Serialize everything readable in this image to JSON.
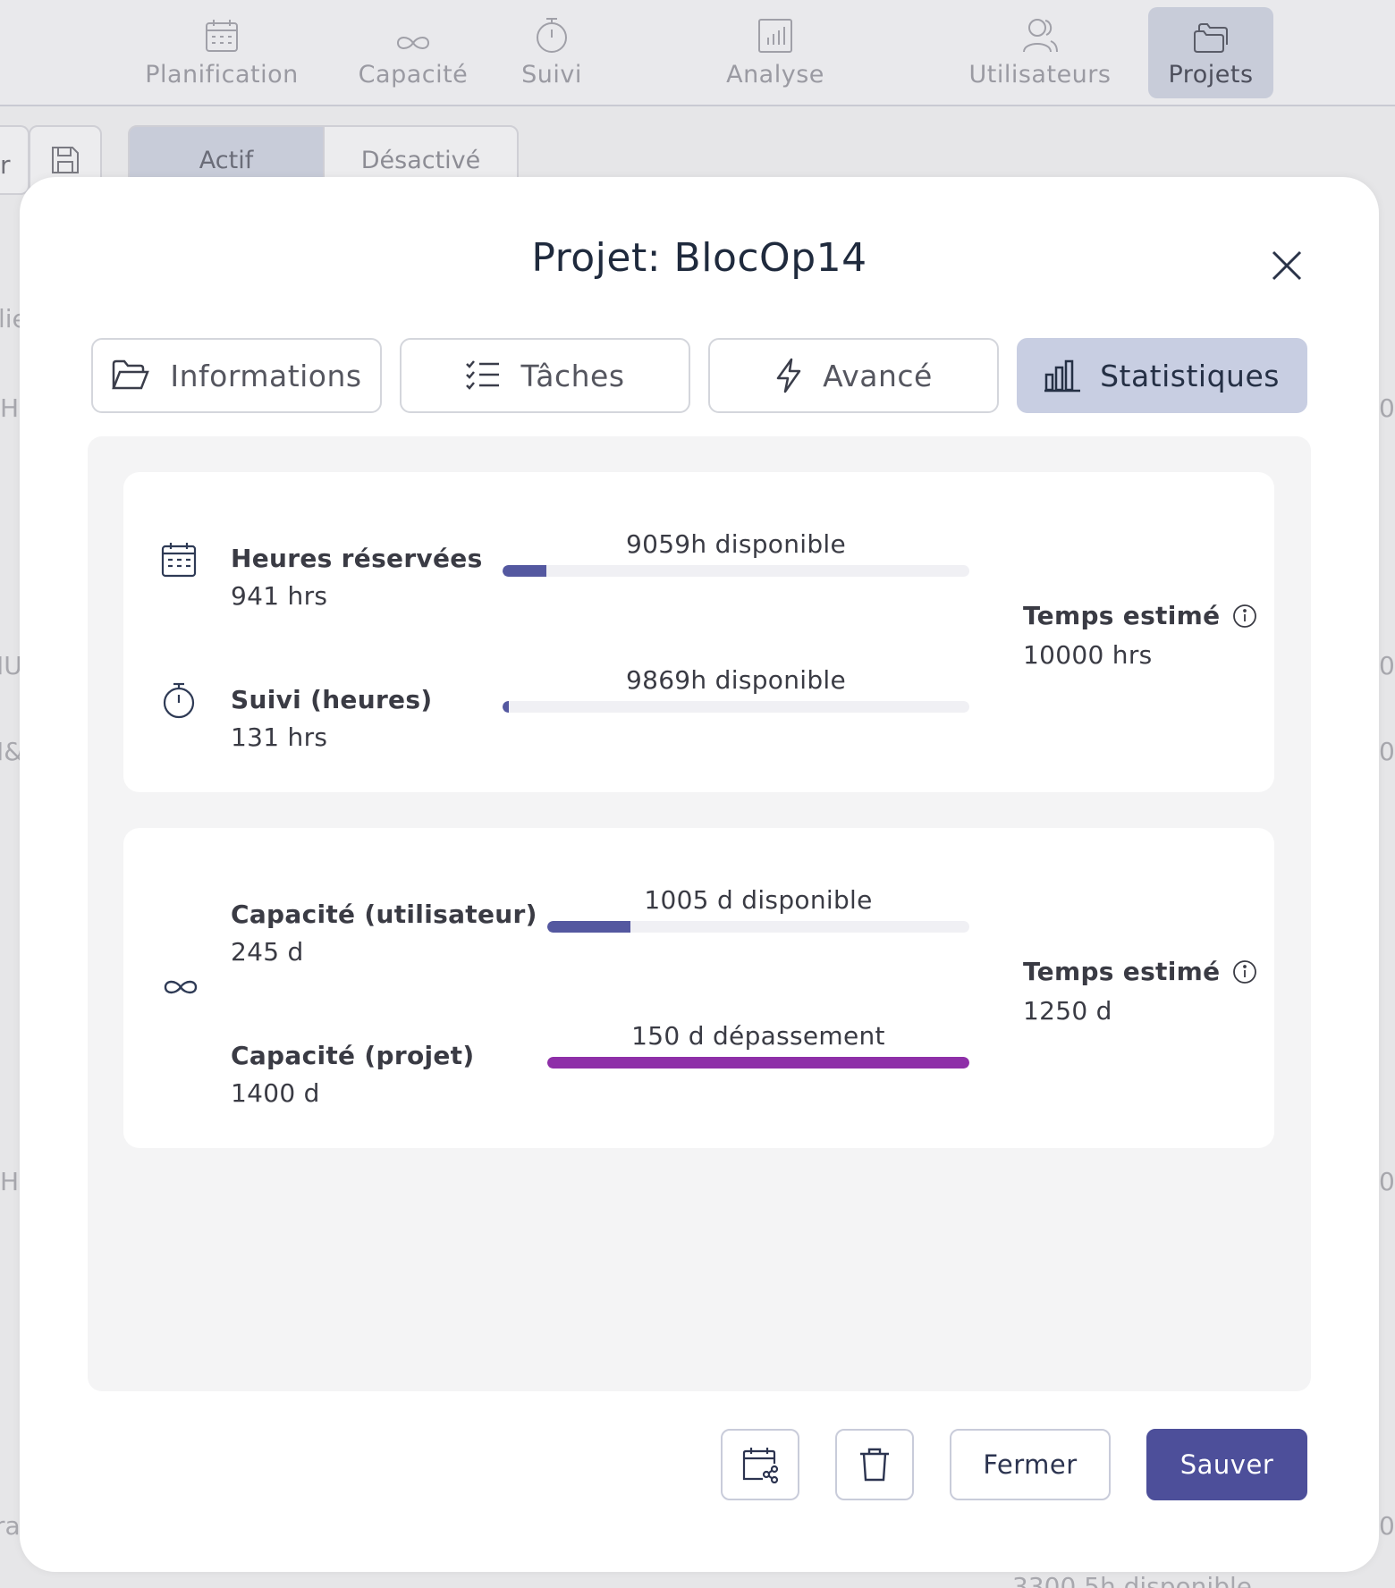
{
  "nav": {
    "items": [
      {
        "label": "Planification",
        "icon": "calendar-icon"
      },
      {
        "label": "Capacité",
        "icon": "infinity-icon"
      },
      {
        "label": "Suivi",
        "icon": "stopwatch-icon"
      },
      {
        "label": "Analyse",
        "icon": "bar-chart-icon"
      },
      {
        "label": "Utilisateurs",
        "icon": "users-icon"
      },
      {
        "label": "Projets",
        "icon": "folders-icon"
      }
    ],
    "active": "Projets"
  },
  "toolbar": {
    "search_fragment": "r",
    "segments": [
      "Actif",
      "Désactivé"
    ],
    "active_segment": "Actif"
  },
  "background_fragments": [
    "lie",
    "H",
    "IU",
    "I&",
    "H",
    "ra",
    "0",
    "0",
    "0",
    "0",
    "0",
    "3300.5h disponible"
  ],
  "modal": {
    "title": "Projet: BlocOp14",
    "tabs": [
      {
        "label": "Informations",
        "icon": "folder-open-icon"
      },
      {
        "label": "Tâches",
        "icon": "checklist-icon"
      },
      {
        "label": "Avancé",
        "icon": "lightning-icon"
      },
      {
        "label": "Statistiques",
        "icon": "bar-chart-icon"
      }
    ],
    "active_tab": "Statistiques"
  },
  "hours_card": {
    "reserved": {
      "label": "Heures réservées",
      "value": "941 hrs",
      "caption": "9059h disponible",
      "fill": 0.094
    },
    "tracked": {
      "label": "Suivi (heures)",
      "value": "131 hrs",
      "caption": "9869h disponible",
      "fill": 0.013
    },
    "estimate": {
      "label": "Temps estimé",
      "value": "10000 hrs"
    }
  },
  "capacity_card": {
    "user": {
      "label": "Capacité (utilisateur)",
      "value": "245 d",
      "caption": "1005 d disponible",
      "fill": 0.196
    },
    "project": {
      "label": "Capacité (projet)",
      "value": "1400 d",
      "caption": "150 d dépassement",
      "fill": 1.0
    },
    "estimate": {
      "label": "Temps estimé",
      "value": "1250 d"
    }
  },
  "footer": {
    "close_label": "Fermer",
    "save_label": "Sauver"
  },
  "colors": {
    "accent": "#4d4f9a",
    "bar_primary": "#5458a0",
    "bar_overflow": "#8e2fa8",
    "active_tab_bg": "#c8cee2"
  }
}
